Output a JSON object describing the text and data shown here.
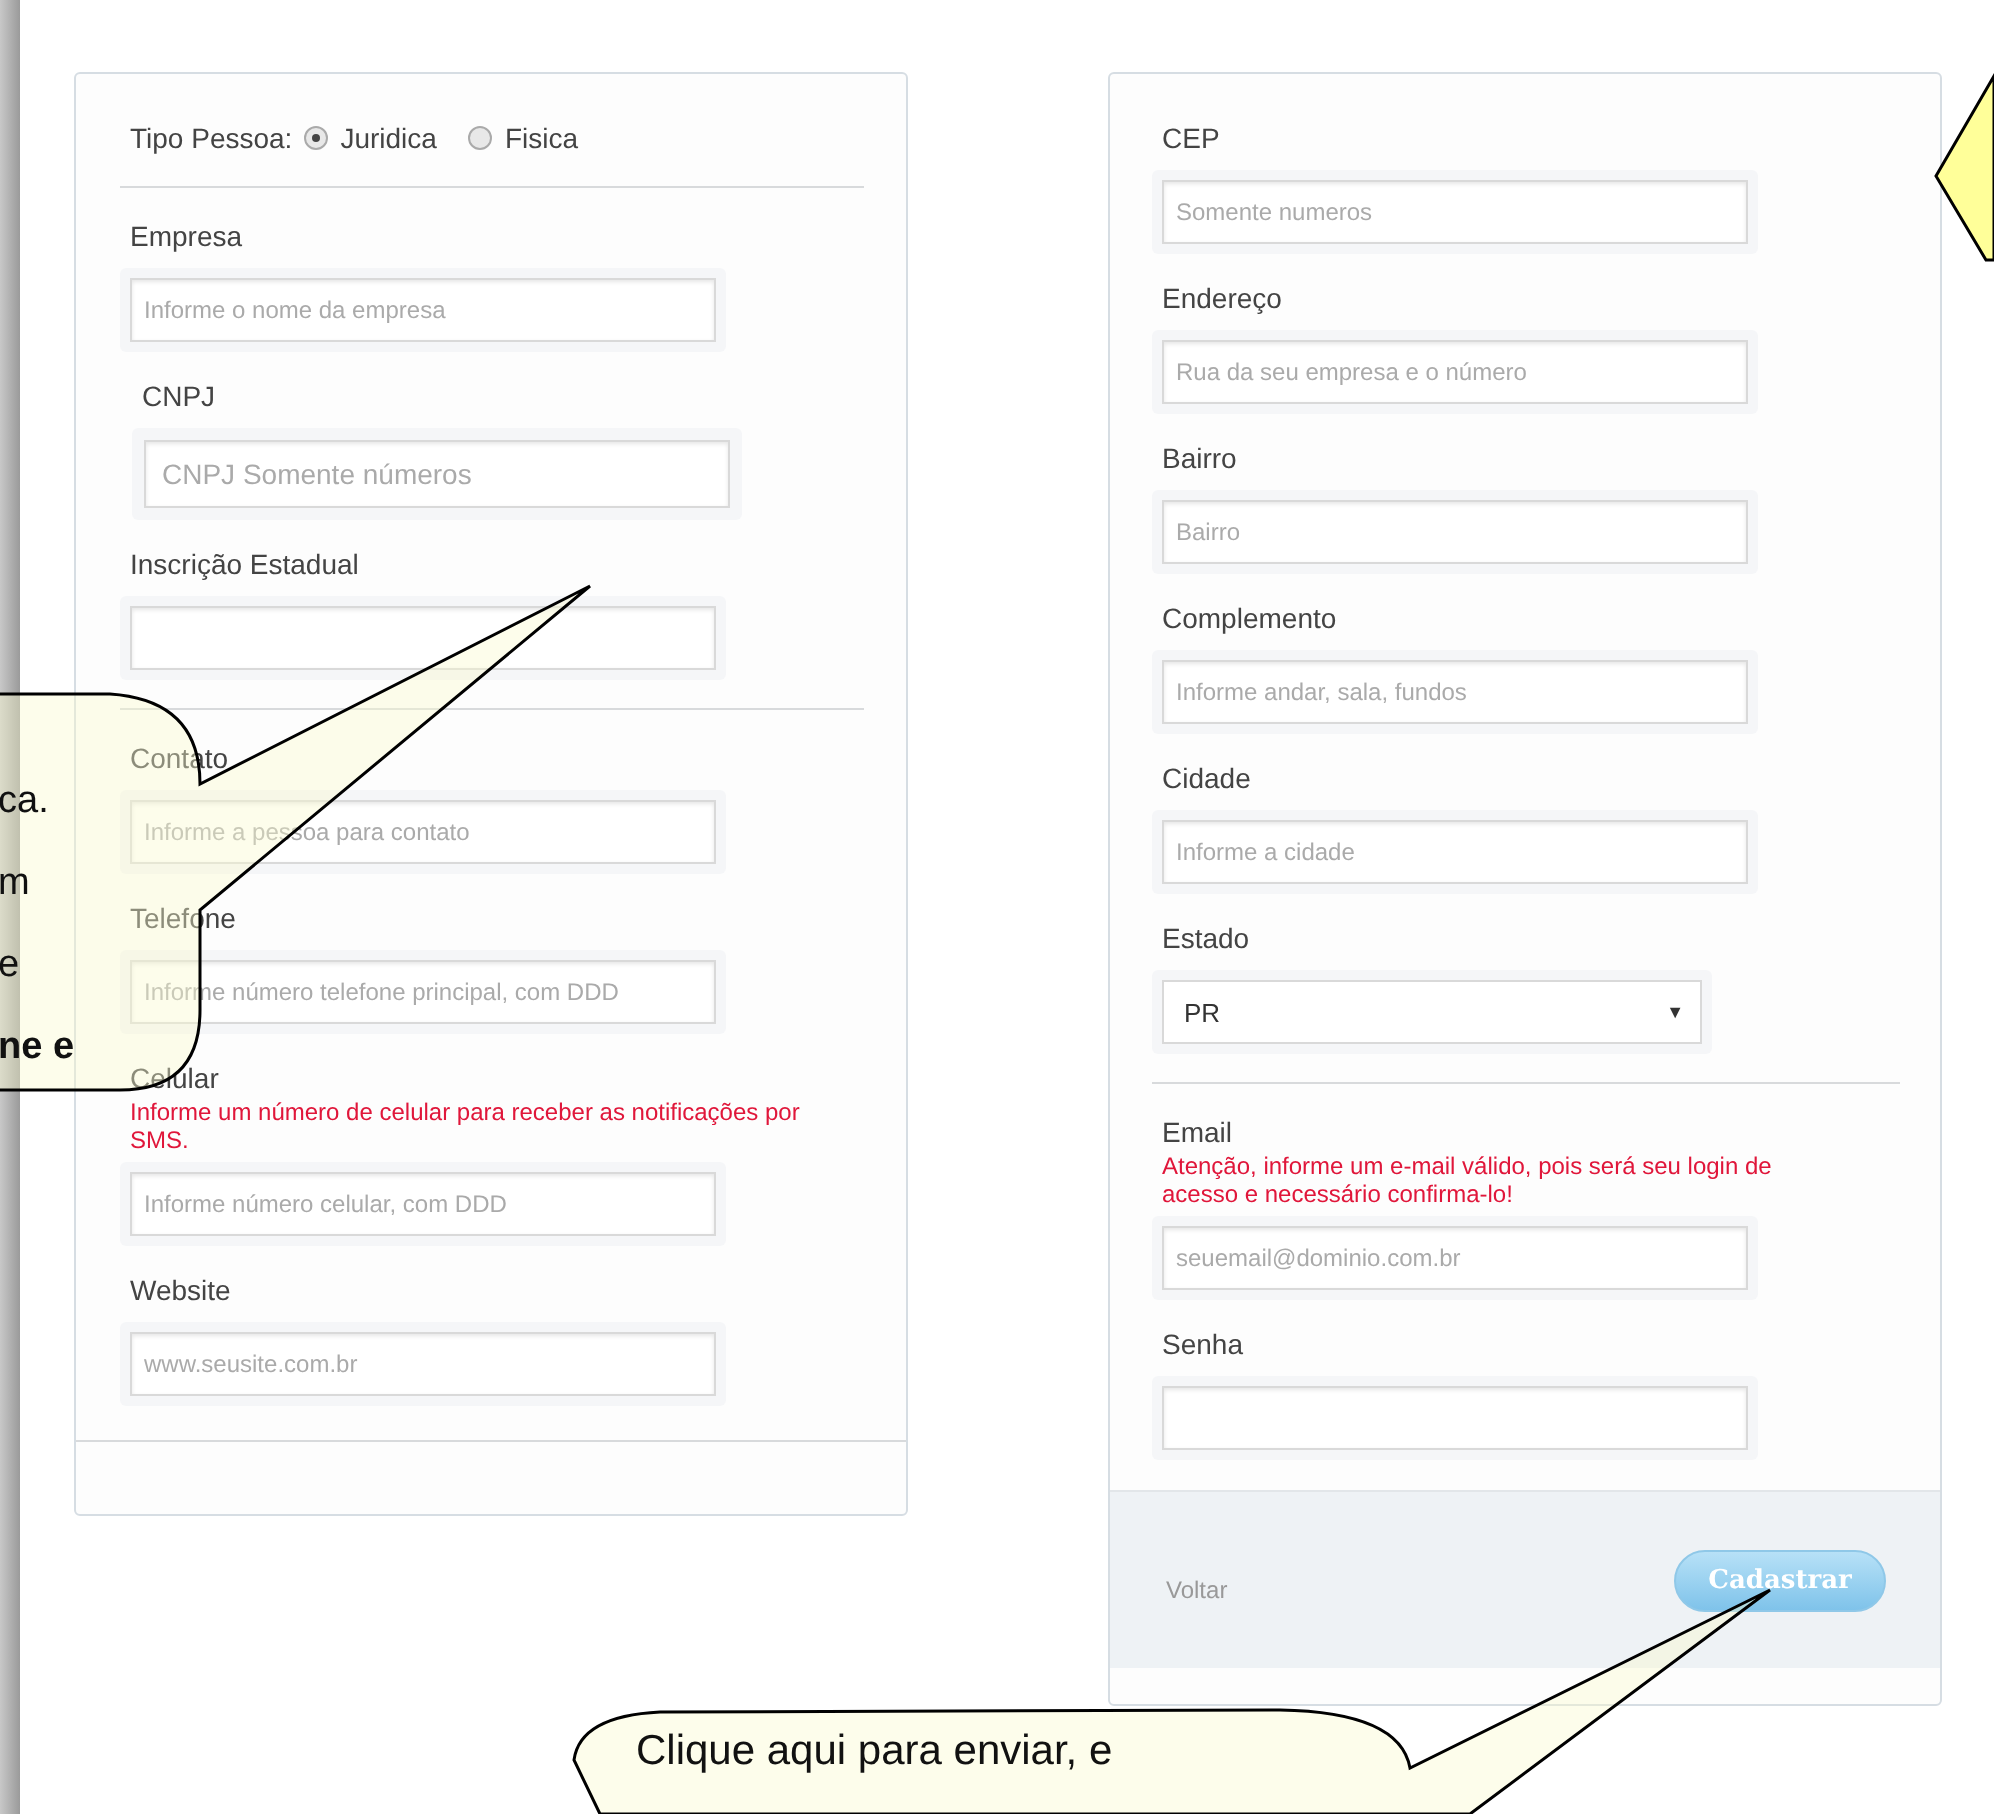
{
  "left_card": {
    "person_type": {
      "label": "Tipo Pessoa:",
      "options": [
        {
          "label": "Juridica",
          "selected": true
        },
        {
          "label": "Fisica",
          "selected": false
        }
      ]
    },
    "groups": [
      [
        {
          "kind": "text",
          "label": "Empresa",
          "placeholder": "Informe o nome da empresa"
        },
        {
          "kind": "large",
          "label": "CNPJ",
          "placeholder": "CNPJ Somente números"
        },
        {
          "kind": "text",
          "label": "Inscrição Estadual"
        }
      ],
      [
        {
          "kind": "text",
          "label": "Contato",
          "placeholder": "Informe a pessoa para contato"
        },
        {
          "kind": "text",
          "label": "Telefone",
          "placeholder": "Informe número telefone principal, com DDD"
        },
        {
          "kind": "text",
          "label": "Celular",
          "hint": "Informe um número de celular para receber as notificações por SMS.",
          "placeholder": "Informe número celular, com DDD"
        },
        {
          "kind": "text",
          "label": "Website",
          "placeholder": "www.seusite.com.br"
        }
      ]
    ]
  },
  "right_card": {
    "groups": [
      [
        {
          "kind": "text",
          "label": "CEP",
          "placeholder": "Somente numeros"
        },
        {
          "kind": "text",
          "label": "Endereço",
          "placeholder": "Rua da seu empresa e o número"
        },
        {
          "kind": "text",
          "label": "Bairro",
          "placeholder": "Bairro"
        },
        {
          "kind": "text",
          "label": "Complemento",
          "placeholder": "Informe andar, sala, fundos"
        },
        {
          "kind": "text",
          "label": "Cidade",
          "placeholder": "Informe a cidade"
        },
        {
          "kind": "select",
          "label": "Estado",
          "value": "PR",
          "arrow": "▼"
        }
      ],
      [
        {
          "kind": "text",
          "label": "Email",
          "hint": "Atenção, informe um e-mail válido, pois será seu login de acesso e necessário confirma-lo!",
          "placeholder": "seuemail@dominio.com.br"
        },
        {
          "kind": "text",
          "label": "Senha"
        }
      ]
    ],
    "footer": {
      "back_link": "Voltar",
      "submit_button": "Cadastrar"
    }
  },
  "callouts": {
    "left": {
      "lines": [
        {
          "text": "ca.",
          "bold": false
        },
        {
          "text": "m",
          "bold": false
        },
        {
          "text": "e",
          "bold": false
        },
        {
          "text": "ne e",
          "bold": true
        }
      ]
    },
    "bottom": {
      "lines": [
        {
          "text": "Clique aqui para enviar, e",
          "bold": false
        }
      ]
    }
  }
}
